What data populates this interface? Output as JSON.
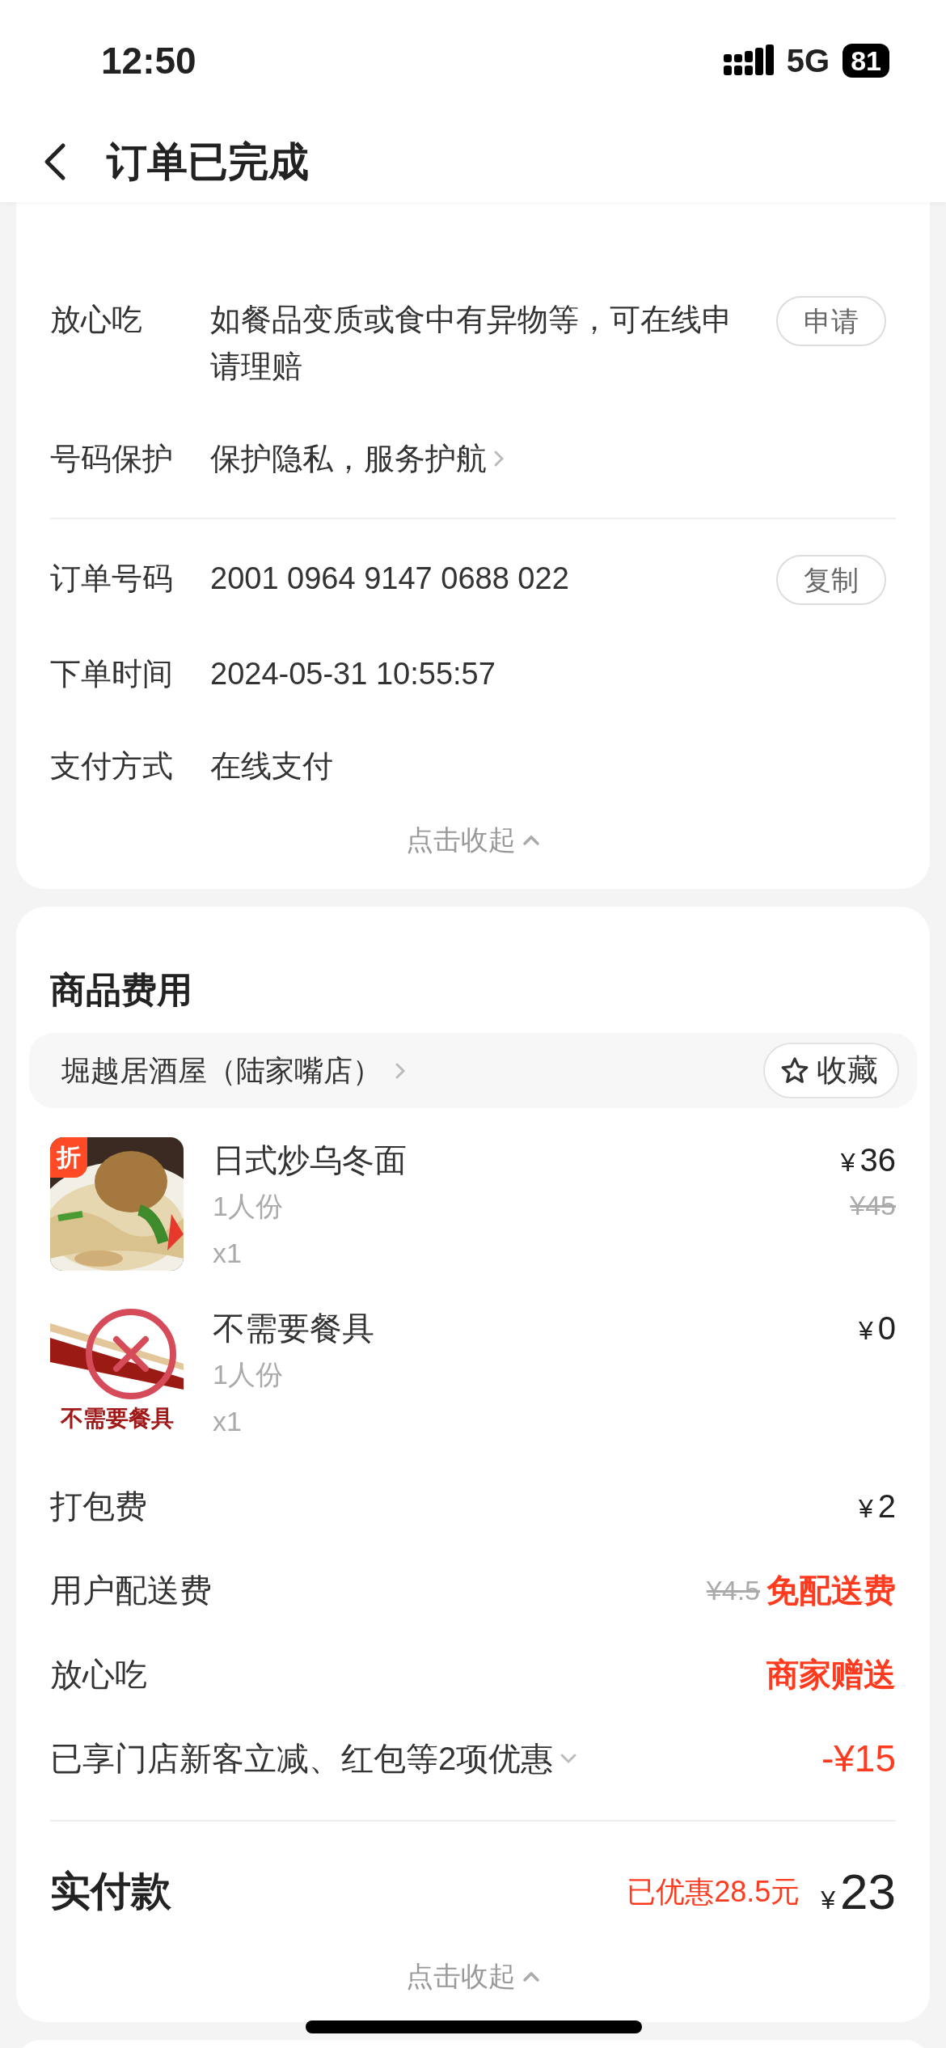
{
  "status_bar": {
    "time": "12:50",
    "network": "5G",
    "battery": "81"
  },
  "header": {
    "title": "订单已完成"
  },
  "order_info": {
    "service_rows": [
      {
        "label": "放心吃",
        "value": "如餐品变质或食中有异物等，可在线申请理赔",
        "kind": "action",
        "action": "申请"
      },
      {
        "label": "号码保护",
        "value": "保护隐私，服务护航",
        "kind": "link"
      }
    ],
    "order_rows": [
      {
        "label": "订单号码",
        "value": "2001 0964 9147 0688 022",
        "kind": "action",
        "action": "复制"
      },
      {
        "label": "下单时间",
        "value": "2024-05-31 10:55:57",
        "kind": "plain"
      },
      {
        "label": "支付方式",
        "value": "在线支付",
        "kind": "plain"
      }
    ],
    "collapse": "点击收起"
  },
  "costs": {
    "title": "商品费用",
    "store": {
      "name": "堀越居酒屋（陆家嘴店）",
      "favorite": "收藏"
    },
    "items": [
      {
        "name": "日式炒乌冬面",
        "portion": "1人份",
        "quantity": "x1",
        "currency": "¥",
        "price": "36",
        "original_price": "¥45",
        "tag": "折",
        "kind": "noodles"
      },
      {
        "name": "不需要餐具",
        "portion": "1人份",
        "quantity": "x1",
        "currency": "¥",
        "price": "0",
        "image_caption": "不需要餐具",
        "kind": "no-utensils"
      }
    ],
    "fees": [
      {
        "label": "打包费",
        "kind": "price",
        "currency": "¥",
        "value": "2"
      },
      {
        "label": "用户配送费",
        "kind": "promo",
        "original": "¥4.5",
        "value": "免配送费"
      },
      {
        "label": "放心吃",
        "kind": "promo",
        "value": "商家赠送"
      },
      {
        "label": "已享门店新客立减、红包等2项优惠",
        "kind": "discount",
        "value": "-¥15",
        "expanded": false
      }
    ],
    "total": {
      "label": "实付款",
      "saved": "已优惠28.5元",
      "currency": "¥",
      "amount": "23"
    },
    "collapse": "点击收起"
  }
}
